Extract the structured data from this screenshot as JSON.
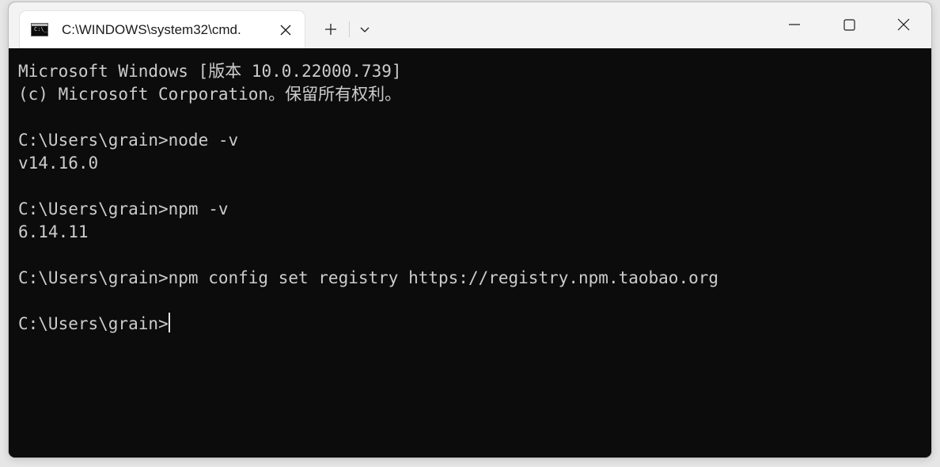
{
  "tab": {
    "title": "C:\\WINDOWS\\system32\\cmd.",
    "icon": "cmd-icon",
    "icon_prompt": "C:\\_"
  },
  "titlebar": {
    "new_tab_icon": "plus-icon",
    "dropdown_icon": "chevron-down-icon",
    "minimize_icon": "minimize-icon",
    "maximize_icon": "maximize-icon",
    "close_icon": "close-icon"
  },
  "colors": {
    "terminal_background": "#0c0c0c",
    "terminal_text": "#cccccc",
    "titlebar_background": "#f3f3f3",
    "tab_background": "#ffffff"
  },
  "terminal": {
    "lines": [
      "Microsoft Windows [版本 10.0.22000.739]",
      "(c) Microsoft Corporation。保留所有权利。",
      "",
      "C:\\Users\\grain>node -v",
      "v14.16.0",
      "",
      "C:\\Users\\grain>npm -v",
      "6.14.11",
      "",
      "C:\\Users\\grain>npm config set registry https://registry.npm.taobao.org",
      "",
      "C:\\Users\\grain>"
    ]
  }
}
